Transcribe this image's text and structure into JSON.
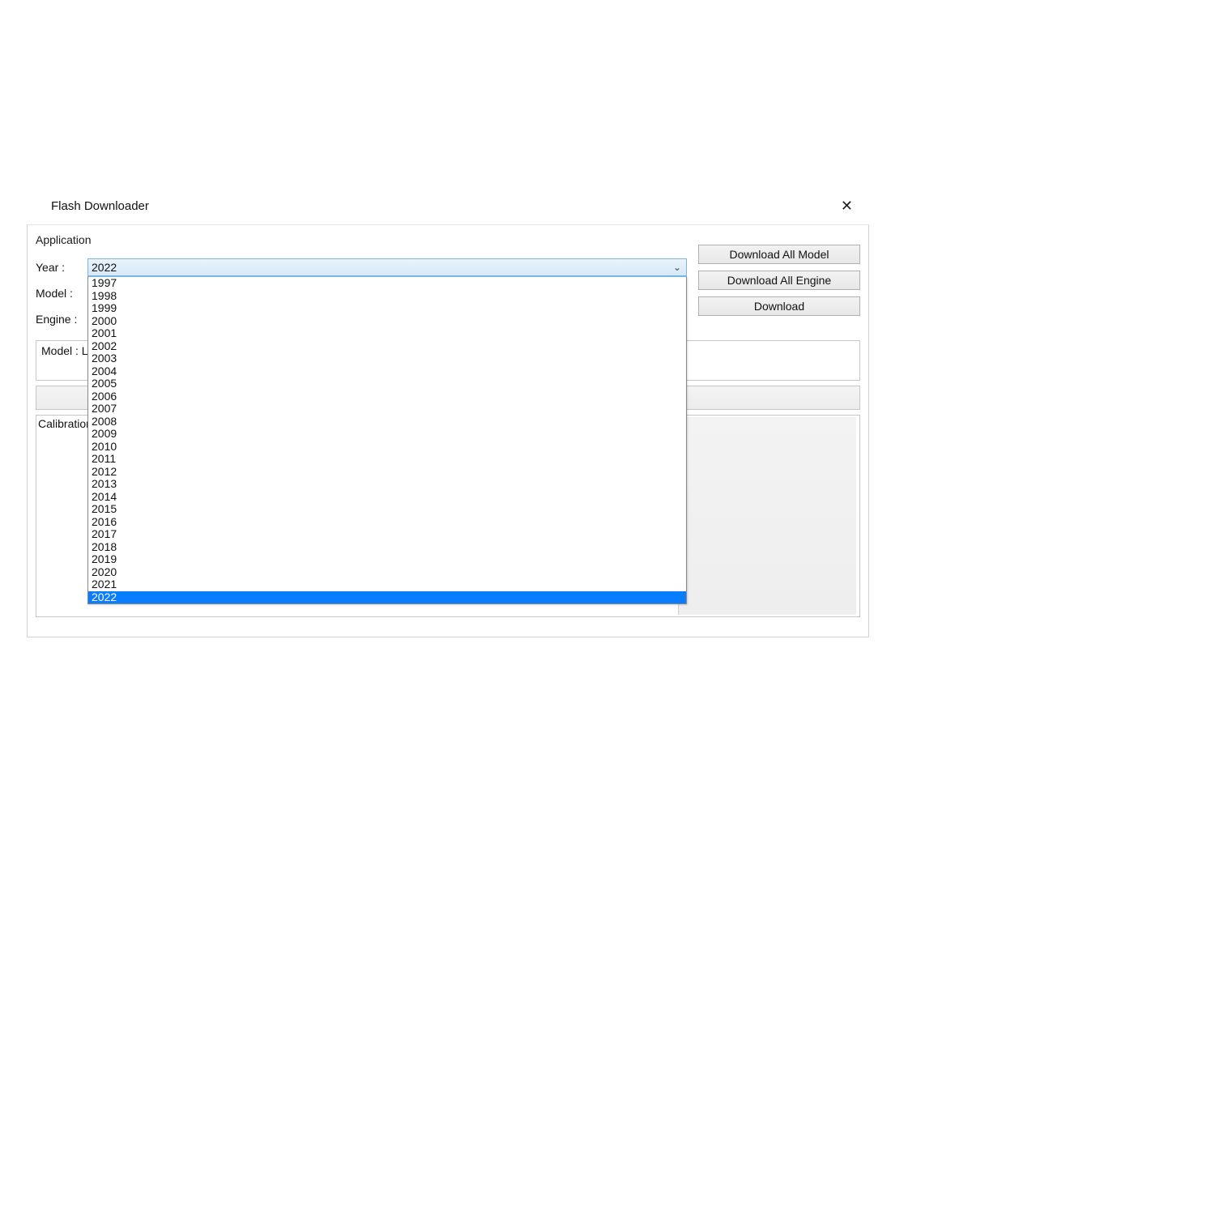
{
  "window": {
    "title": "Flash Downloader",
    "close_label": "✕"
  },
  "menu": {
    "application": "Application"
  },
  "labels": {
    "year": "Year :",
    "model": "Model :",
    "engine": "Engine :",
    "model_box_prefix": "Model : L",
    "calibration": "Calibration"
  },
  "year": {
    "selected": "2022",
    "options": [
      "1997",
      "1998",
      "1999",
      "2000",
      "2001",
      "2002",
      "2003",
      "2004",
      "2005",
      "2006",
      "2007",
      "2008",
      "2009",
      "2010",
      "2011",
      "2012",
      "2013",
      "2014",
      "2015",
      "2016",
      "2017",
      "2018",
      "2019",
      "2020",
      "2021",
      "2022"
    ]
  },
  "buttons": {
    "download_all_model": "Download All Model",
    "download_all_engine": "Download All Engine",
    "download": "Download"
  }
}
